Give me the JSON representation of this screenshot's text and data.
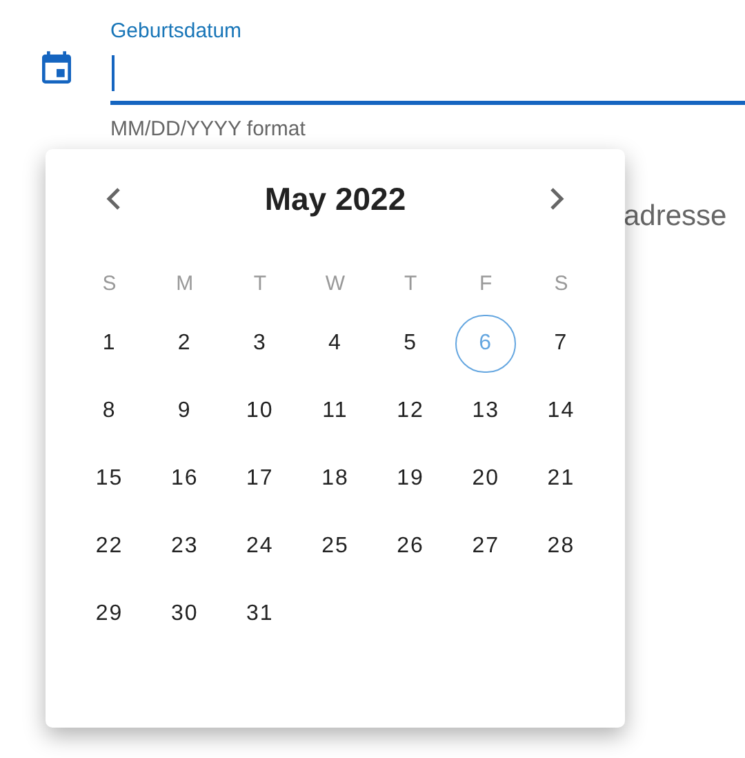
{
  "date_field": {
    "label": "Geburtsdatum",
    "focused": true,
    "helper": "MM/DD/YYYY format"
  },
  "address_field": {
    "label": "adresse"
  },
  "calendar": {
    "title": "May 2022",
    "weekdays": [
      "S",
      "M",
      "T",
      "W",
      "T",
      "F",
      "S"
    ],
    "weeks": [
      [
        {
          "day": "1",
          "today": false
        },
        {
          "day": "2",
          "today": false
        },
        {
          "day": "3",
          "today": false
        },
        {
          "day": "4",
          "today": false
        },
        {
          "day": "5",
          "today": false
        },
        {
          "day": "6",
          "today": true
        },
        {
          "day": "7",
          "today": false
        }
      ],
      [
        {
          "day": "8",
          "today": false
        },
        {
          "day": "9",
          "today": false
        },
        {
          "day": "10",
          "today": false
        },
        {
          "day": "11",
          "today": false
        },
        {
          "day": "12",
          "today": false
        },
        {
          "day": "13",
          "today": false
        },
        {
          "day": "14",
          "today": false
        }
      ],
      [
        {
          "day": "15",
          "today": false
        },
        {
          "day": "16",
          "today": false
        },
        {
          "day": "17",
          "today": false
        },
        {
          "day": "18",
          "today": false
        },
        {
          "day": "19",
          "today": false
        },
        {
          "day": "20",
          "today": false
        },
        {
          "day": "21",
          "today": false
        }
      ],
      [
        {
          "day": "22",
          "today": false
        },
        {
          "day": "23",
          "today": false
        },
        {
          "day": "24",
          "today": false
        },
        {
          "day": "25",
          "today": false
        },
        {
          "day": "26",
          "today": false
        },
        {
          "day": "27",
          "today": false
        },
        {
          "day": "28",
          "today": false
        }
      ],
      [
        {
          "day": "29",
          "today": false
        },
        {
          "day": "30",
          "today": false
        },
        {
          "day": "31",
          "today": false
        }
      ]
    ]
  }
}
